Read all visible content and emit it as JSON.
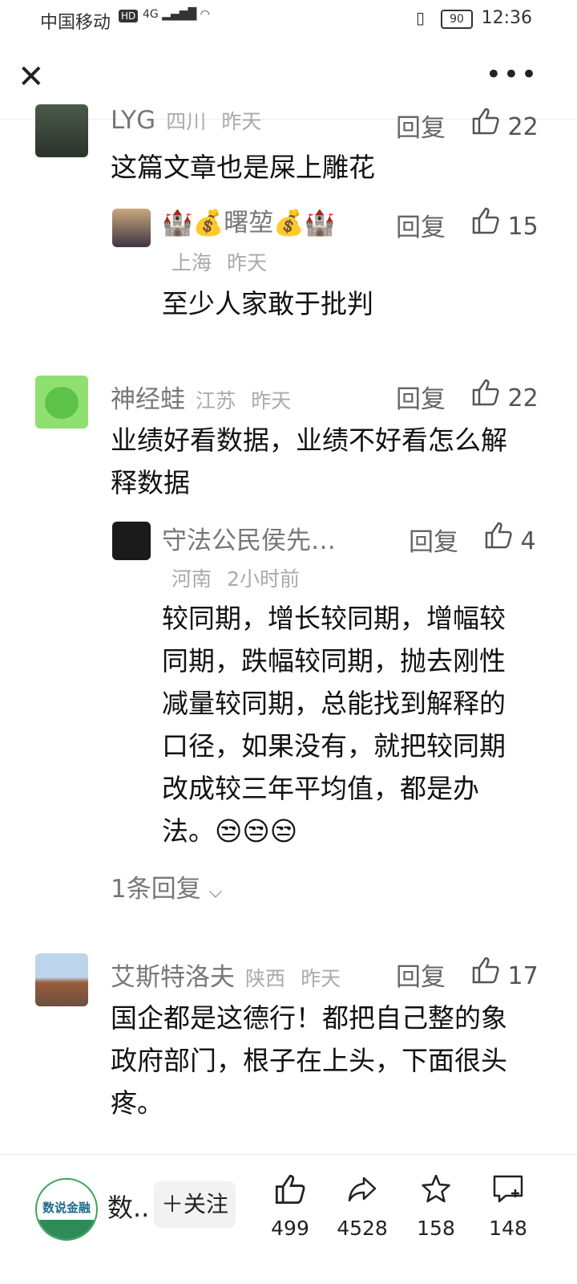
{
  "status_bar": {
    "carrier": "中国移动",
    "hd": "HD",
    "network": "4G",
    "battery": "90",
    "time": "12:36"
  },
  "comments": [
    {
      "name": "LYG",
      "location": "四川",
      "time": "昨天",
      "reply_label": "回复",
      "likes": "22",
      "content": "这篇文章也是屎上雕花",
      "replies": [
        {
          "name": "🏰💰曙堃💰🏰",
          "location": "上海",
          "time": "昨天",
          "reply_label": "回复",
          "likes": "15",
          "content": "至少人家敢于批判"
        }
      ]
    },
    {
      "name": "神经蛙",
      "location": "江苏",
      "time": "昨天",
      "reply_label": "回复",
      "likes": "22",
      "content_lines": [
        "业绩好看数据，业绩不好看怎么解",
        "释数据"
      ],
      "replies": [
        {
          "name": "守法公民侯先…",
          "location": "河南",
          "time": "2小时前",
          "reply_label": "回复",
          "likes": "4",
          "content_lines": [
            "较同期，增长较同期，增幅较",
            "同期，跌幅较同期，抛去刚性",
            "减量较同期，总能找到解释的",
            "口径，如果没有，就把较同期",
            "改成较三年平均值，都是办",
            "法。😒😒😒"
          ]
        }
      ],
      "more_replies": "1条回复"
    },
    {
      "name": "艾斯特洛夫",
      "location": "陕西",
      "time": "昨天",
      "reply_label": "回复",
      "likes": "17",
      "content_lines": [
        "国企都是这德行！都把自己整的象",
        "政府部门，根子在上头，下面很头",
        "疼。"
      ]
    }
  ],
  "bottom_bar": {
    "account_logo_text": "数说金融",
    "account_name": "数..",
    "follow_label": "＋关注",
    "likes": "499",
    "shares": "4528",
    "favorites": "158",
    "comments": "148"
  }
}
